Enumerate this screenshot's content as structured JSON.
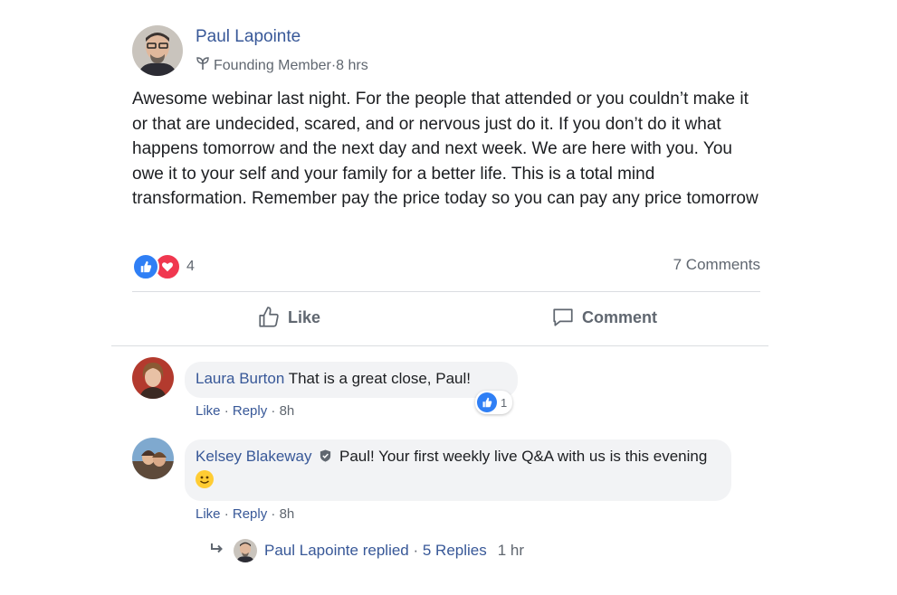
{
  "post": {
    "author": "Paul Lapointe",
    "badge": "Founding Member",
    "time": "8 hrs",
    "separator": " · ",
    "text": "Awesome webinar last night. For the people that attended or you couldn’t make it or that are undecided, scared, and or nervous just do it. If you don’t do it what happens tomorrow and the next day and next week. We are here with you. You owe it to your self and your family for a better life. This is a total mind transformation. Remember pay the price today so you can pay any price tomorrow",
    "reaction_count": "4",
    "comment_count": "7 Comments",
    "actions": {
      "like": "Like",
      "comment": "Comment"
    }
  },
  "comments": [
    {
      "name": "Laura Burton",
      "text": "That is a great close, Paul!",
      "actions": {
        "like": "Like",
        "reply": "Reply",
        "time": "8h"
      },
      "reaction_count": "1"
    },
    {
      "name": "Kelsey Blakeway",
      "text": "Paul! Your first weekly live Q&A with us is this evening",
      "actions": {
        "like": "Like",
        "reply": "Reply",
        "time": "8h"
      },
      "replies": {
        "author": "Paul Lapointe",
        "text": "replied",
        "count": "5 Replies",
        "time": "1 hr"
      }
    }
  ],
  "icons": {
    "sprout": "sprout-icon",
    "like_reaction": "thumbs-up-icon",
    "love_reaction": "heart-icon",
    "like_action": "thumbs-up-outline-icon",
    "comment_action": "speech-bubble-icon",
    "admin_badge": "shield-icon",
    "reply_arrow": "reply-arrow-icon",
    "emoji": "smiley-icon"
  },
  "colors": {
    "link": "#385898",
    "like_blue": "#2f7ff5",
    "love_red": "#f0374f",
    "muted": "#606770"
  }
}
